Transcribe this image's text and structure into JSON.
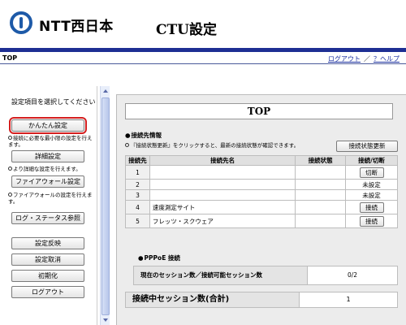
{
  "header": {
    "logo_text": "NTT西日本",
    "title": "CTU設定"
  },
  "subbar": {
    "page": "TOP",
    "logout": "ログアウト",
    "separator": "／",
    "help": "？ヘルプ"
  },
  "sidebar": {
    "heading": "設定項目を選択してください",
    "easy_setup": "かんたん設定",
    "easy_desc": "接続に必要な最小限の設定を行えます。",
    "detail_setup": "詳細設定",
    "detail_desc": "より詳細な設定を行えます。",
    "firewall_setup": "ファイアウォール設定",
    "firewall_desc": "ファイアウォールの設定を行えます。",
    "log_status": "ログ・ステータス参照",
    "apply": "設定反映",
    "cancel": "設定取消",
    "init": "初期化",
    "logout": "ログアウト"
  },
  "main": {
    "title": "TOP",
    "conn_info_head": "接続先情報",
    "conn_info_note": "『接続状態更新』をクリックすると、最新の接続状態が確認できます。",
    "refresh_button": "接続状態更新",
    "table": {
      "headers": [
        "接続先",
        "接続先名",
        "接続状態",
        "接続/切断"
      ],
      "rows": [
        {
          "num": "1",
          "name": "",
          "state": "",
          "action": "切断",
          "action_type": "button"
        },
        {
          "num": "2",
          "name": "",
          "state": "",
          "action": "未設定",
          "action_type": "text"
        },
        {
          "num": "3",
          "name": "",
          "state": "",
          "action": "未設定",
          "action_type": "text"
        },
        {
          "num": "4",
          "name": "速度測定サイト",
          "state": "",
          "action": "接続",
          "action_type": "button"
        },
        {
          "num": "5",
          "name": "フレッツ・スクウェア",
          "state": "",
          "action": "接続",
          "action_type": "button"
        }
      ]
    },
    "pppoe_head": "PPPoE 接続",
    "pppoe_label": "現在のセッション数／接続可能セッション数",
    "pppoe_value": "0/2",
    "total_label": "接続中セッション数(合計)",
    "total_value": "1"
  },
  "colors": {
    "brand_blue": "#1e5aa8",
    "header_bar": "#1e2f93",
    "highlight_red": "#d41e1e",
    "link_blue": "#1a2fa0"
  }
}
